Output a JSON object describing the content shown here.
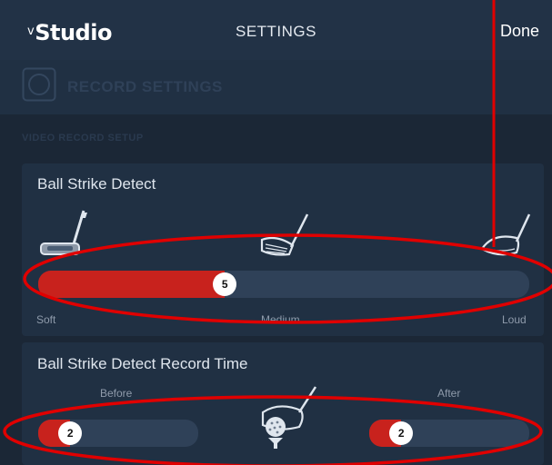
{
  "nav": {
    "logo_prefix": "v",
    "logo_name": "Studio",
    "title": "SETTINGS",
    "done_label": "Done"
  },
  "section": {
    "title": "RECORD SETTINGS",
    "subheader": "VIDEO RECORD SETUP"
  },
  "ball_strike_detect": {
    "label": "Ball Strike Detect",
    "value": "5",
    "level_fraction": 0.38,
    "labels": {
      "soft": "Soft",
      "medium": "Medium",
      "loud": "Loud"
    }
  },
  "record_time": {
    "label": "Ball Strike Detect Record Time",
    "before": {
      "label": "Before",
      "value": "2",
      "level_fraction": 0.2
    },
    "after": {
      "label": "After",
      "value": "2",
      "level_fraction": 0.2
    }
  },
  "colors": {
    "accent": "#c8221d",
    "annotation": "#e00000",
    "background": "#1b2736",
    "panel": "#203043",
    "track": "#2f4158"
  },
  "icons": [
    "camera-icon",
    "putter-icon",
    "iron-icon",
    "driver-icon",
    "golf-ball-club-icon"
  ]
}
